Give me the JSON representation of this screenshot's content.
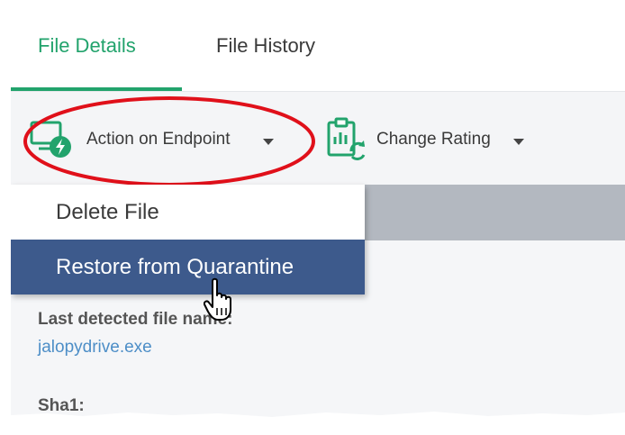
{
  "tabs": [
    {
      "label": "File Details",
      "active": true
    },
    {
      "label": "File History",
      "active": false
    }
  ],
  "toolbar": {
    "action_label": "Action on Endpoint",
    "action_icon": "monitor-lightning-icon",
    "change_label": "Change Rating",
    "change_icon": "clipboard-refresh-icon"
  },
  "dropdown": {
    "items": [
      {
        "label": "Delete File",
        "highlighted": false
      },
      {
        "label": "Restore from Quarantine",
        "highlighted": true
      }
    ]
  },
  "details": {
    "last_detected_label": "Last detected file name:",
    "last_detected_value": "jalopydrive.exe",
    "sha1_label": "Sha1:"
  },
  "colors": {
    "accent_green": "#22a36c",
    "highlight_blue": "#3d5a8c",
    "annotation_red": "#e0101a",
    "link_blue": "#4d8ec7"
  }
}
